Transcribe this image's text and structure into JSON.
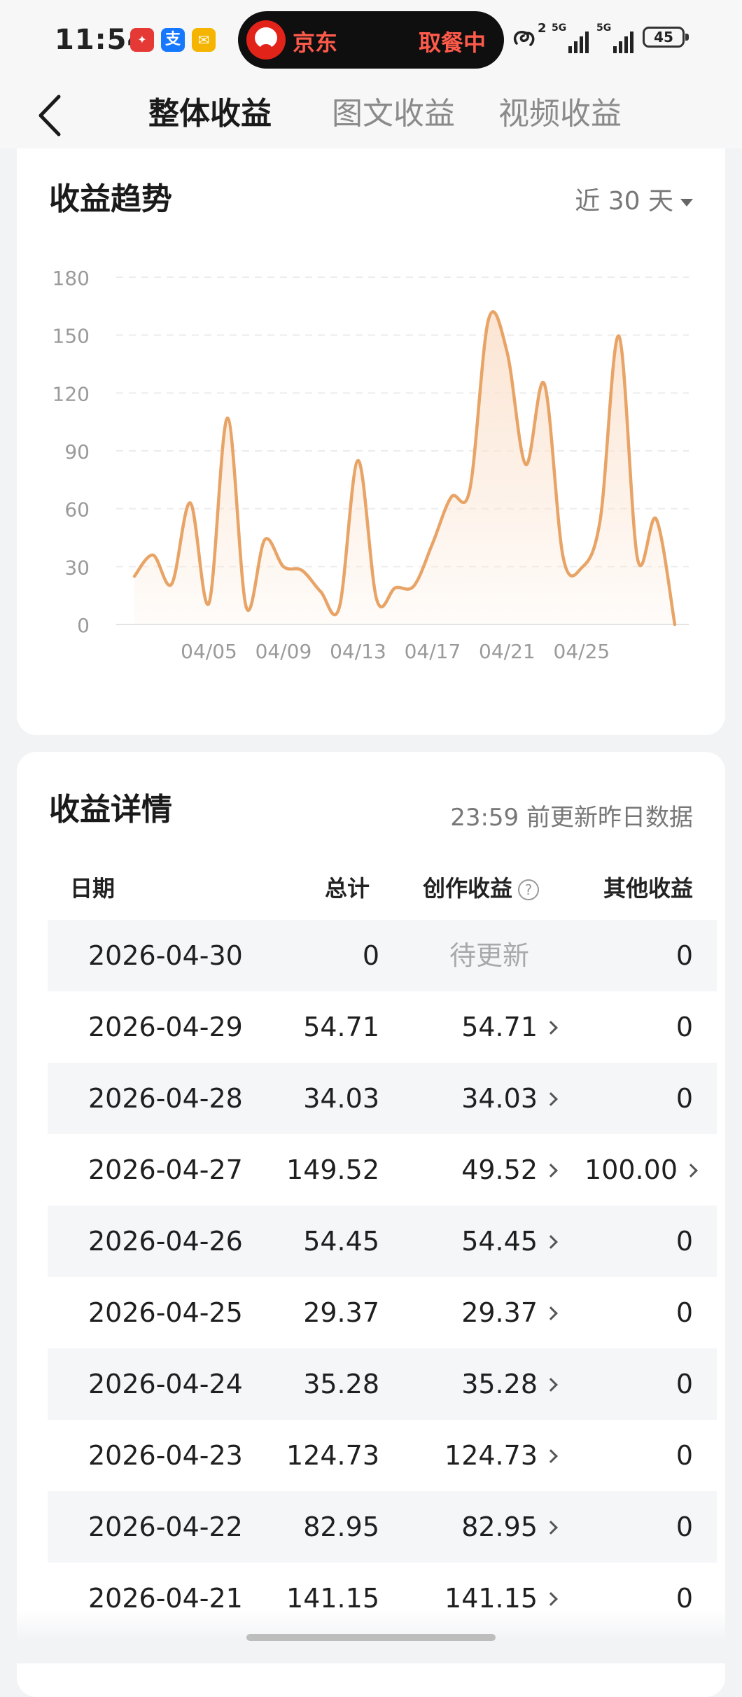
{
  "status_bar": {
    "time": "11:54",
    "app_icons": [
      "news-app-icon",
      "alipay-icon",
      "mail-app-icon"
    ],
    "live_activity": {
      "app": "京东",
      "status": "取餐中"
    },
    "hd_label": "2",
    "signal_1": "5G",
    "signal_2": "5G",
    "battery": "45"
  },
  "header": {
    "tabs": [
      {
        "label": "整体收益",
        "active": true
      },
      {
        "label": "图文收益",
        "active": false
      },
      {
        "label": "视频收益",
        "active": false
      }
    ]
  },
  "trend": {
    "title": "收益趋势",
    "range_label": "近 30 天"
  },
  "chart_data": {
    "type": "area",
    "title": "",
    "xlabel": "",
    "ylabel": "",
    "ylim": [
      0,
      180
    ],
    "yticks": [
      0,
      30,
      60,
      90,
      120,
      150,
      180
    ],
    "xtick_labels": [
      "04/05",
      "04/09",
      "04/13",
      "04/17",
      "04/21",
      "04/25"
    ],
    "xtick_indices": [
      4,
      8,
      12,
      16,
      20,
      24
    ],
    "grid": true,
    "legend": "none",
    "line_color": "#e8a466",
    "fill_color": "#fbe3d0",
    "x": [
      "04/01",
      "04/02",
      "04/03",
      "04/04",
      "04/05",
      "04/06",
      "04/07",
      "04/08",
      "04/09",
      "04/10",
      "04/11",
      "04/12",
      "04/13",
      "04/14",
      "04/15",
      "04/16",
      "04/17",
      "04/18",
      "04/19",
      "04/20",
      "04/21",
      "04/22",
      "04/23",
      "04/24",
      "04/25",
      "04/26",
      "04/27",
      "04/28",
      "04/29",
      "04/30"
    ],
    "values": [
      25,
      36,
      21,
      63,
      11,
      107,
      9,
      44,
      30,
      28,
      17,
      9,
      85,
      13,
      19,
      20,
      42,
      66,
      70,
      158,
      141.15,
      82.95,
      124.73,
      35.28,
      29.37,
      54.45,
      149.52,
      34.03,
      54.71,
      0
    ]
  },
  "detail": {
    "title": "收益详情",
    "update_note": "23:59 前更新昨日数据",
    "columns": {
      "date": "日期",
      "total": "总计",
      "creation": "创作收益",
      "other": "其他收益"
    },
    "rows": [
      {
        "date": "2026-04-30",
        "total": "0",
        "creation": "待更新",
        "other": "0"
      },
      {
        "date": "2026-04-29",
        "total": "54.71",
        "creation": "54.71",
        "other": "0"
      },
      {
        "date": "2026-04-28",
        "total": "34.03",
        "creation": "34.03",
        "other": "0"
      },
      {
        "date": "2026-04-27",
        "total": "149.52",
        "creation": "49.52",
        "other": "100.00"
      },
      {
        "date": "2026-04-26",
        "total": "54.45",
        "creation": "54.45",
        "other": "0"
      },
      {
        "date": "2026-04-25",
        "total": "29.37",
        "creation": "29.37",
        "other": "0"
      },
      {
        "date": "2026-04-24",
        "total": "35.28",
        "creation": "35.28",
        "other": "0"
      },
      {
        "date": "2026-04-23",
        "total": "124.73",
        "creation": "124.73",
        "other": "0"
      },
      {
        "date": "2026-04-22",
        "total": "82.95",
        "creation": "82.95",
        "other": "0"
      },
      {
        "date": "2026-04-21",
        "total": "141.15",
        "creation": "141.15",
        "other": "0"
      }
    ]
  }
}
